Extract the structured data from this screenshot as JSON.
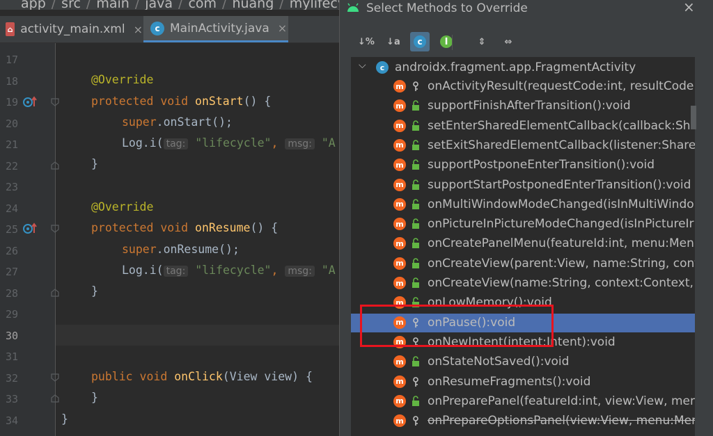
{
  "breadcrumb": [
    "app",
    "src",
    "main",
    "java",
    "com",
    "huang",
    "mylifecycle"
  ],
  "tabs": [
    {
      "label": "activity_main.xml",
      "icon": "xml-file-icon",
      "active": false
    },
    {
      "label": "MainActivity.java",
      "icon": "java-class-icon",
      "active": true
    }
  ],
  "editor": {
    "line_numbers": [
      "17",
      "18",
      "19",
      "20",
      "21",
      "22",
      "23",
      "24",
      "25",
      "26",
      "27",
      "28",
      "29",
      "30",
      "31",
      "32",
      "33",
      "34"
    ],
    "current_line": "30",
    "code": {
      "l18_ann": "@Override",
      "l19_kw": "protected void ",
      "l19_fn": "onStart",
      "l19_rest": "() {",
      "l20_kw": "super",
      "l20_rest": ".onStart();",
      "l21_a": "Log.i(",
      "l21_hint1": "tag:",
      "l21_str1": "\"lifecycle\"",
      "l21_comma": ",",
      "l21_hint2": "msg:",
      "l21_str2": "\"A",
      "l22": "}",
      "l24_ann": "@Override",
      "l25_kw": "protected void ",
      "l25_fn": "onResume",
      "l25_rest": "() {",
      "l26_kw": "super",
      "l26_rest": ".onResume();",
      "l27_a": "Log.i(",
      "l27_hint1": "tag:",
      "l27_str1": "\"lifecycle\"",
      "l27_comma": ",",
      "l27_hint2": "msg:",
      "l27_str2": "\"A",
      "l28": "}",
      "l32_kw": "public void ",
      "l32_fn": "onClick",
      "l32_rest": "(View view) {",
      "l33": "}",
      "l34": "}"
    }
  },
  "dialog": {
    "title": "Select Methods to Override",
    "close": "×",
    "toolbar": [
      {
        "label": "↓%",
        "name": "sort-by-percent-button"
      },
      {
        "label": "↓a",
        "name": "sort-alphabetically-button"
      },
      {
        "label": "c",
        "name": "show-classes-button"
      },
      {
        "label": "I",
        "name": "show-interfaces-button"
      },
      {
        "label": "⇕",
        "name": "expand-all-button"
      },
      {
        "label": "⇔",
        "name": "collapse-all-button"
      }
    ],
    "root": "androidx.fragment.app.FragmentActivity",
    "methods": [
      {
        "text": "onActivityResult(requestCode:int, resultCode:i",
        "vis": "protected"
      },
      {
        "text": "supportFinishAfterTransition():void",
        "vis": "public"
      },
      {
        "text": "setEnterSharedElementCallback(callback:Shar",
        "vis": "public"
      },
      {
        "text": "setExitSharedElementCallback(listener:Shared",
        "vis": "public"
      },
      {
        "text": "supportPostponeEnterTransition():void",
        "vis": "public"
      },
      {
        "text": "supportStartPostponedEnterTransition():void",
        "vis": "public"
      },
      {
        "text": "onMultiWindowModeChanged(isInMultiWindo",
        "vis": "public"
      },
      {
        "text": "onPictureInPictureModeChanged(isInPictureIr",
        "vis": "public"
      },
      {
        "text": "onCreatePanelMenu(featureId:int, menu:Menu",
        "vis": "public"
      },
      {
        "text": "onCreateView(parent:View, name:String, conte",
        "vis": "public"
      },
      {
        "text": "onCreateView(name:String, context:Context, a",
        "vis": "public"
      },
      {
        "text": "onLowMemory():void",
        "vis": "public"
      },
      {
        "text": "onPause():void",
        "vis": "protected",
        "selected": true
      },
      {
        "text": "onNewIntent(intent:Intent):void",
        "vis": "protected"
      },
      {
        "text": "onStateNotSaved():void",
        "vis": "public"
      },
      {
        "text": "onResumeFragments():void",
        "vis": "protected"
      },
      {
        "text": "onPreparePanel(featureId:int, view:View, menu",
        "vis": "public"
      },
      {
        "text": "onPrepareOptionsPanel(view:View, menu:Mer",
        "vis": "protected",
        "strike": true
      }
    ]
  },
  "colors": {
    "selection": "#4b6eaf",
    "highlight_box": "#e8141e",
    "method_icon": "#f26522",
    "class_icon": "#3592c4"
  }
}
